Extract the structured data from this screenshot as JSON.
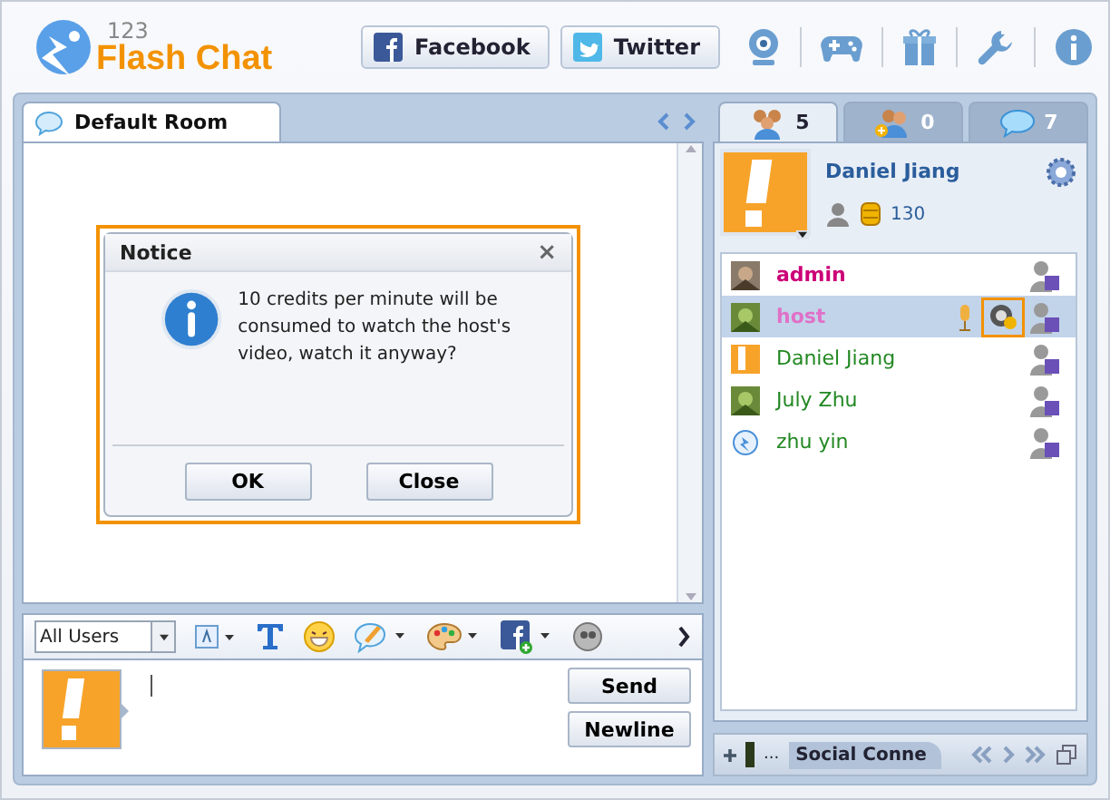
{
  "app": {
    "logo_number": "123",
    "logo_name": "Flash Chat"
  },
  "header_buttons": [
    {
      "label": "Facebook",
      "kind": "facebook"
    },
    {
      "label": "Twitter",
      "kind": "twitter"
    }
  ],
  "room_tabs": [
    {
      "label": "Default Room",
      "selected": true
    }
  ],
  "dialog": {
    "title": "Notice",
    "close": "×",
    "message": "10 credits per minute will be consumed to watch the host's video, watch it anyway?",
    "buttons": [
      "OK",
      "Close"
    ]
  },
  "toolbar": {
    "recipient": "All Users"
  },
  "input": {
    "buttons": [
      "Send",
      "Newline"
    ]
  },
  "side_tabs": [
    {
      "count": "5",
      "kind": "users",
      "selected": true
    },
    {
      "count": "0",
      "kind": "friends",
      "selected": false
    },
    {
      "count": "7",
      "kind": "rooms",
      "selected": false
    }
  ],
  "profile": {
    "name": "Daniel Jiang",
    "credits": "130"
  },
  "users": [
    {
      "name": "admin",
      "color": "#cc0077",
      "bold": true,
      "selected": false,
      "media": false
    },
    {
      "name": "host",
      "color": "#e070c8",
      "bold": true,
      "selected": true,
      "media": true
    },
    {
      "name": "Daniel Jiang",
      "color": "#228822",
      "bold": false,
      "selected": false,
      "kind": "orange",
      "media": false
    },
    {
      "name": "July Zhu",
      "color": "#228822",
      "bold": false,
      "selected": false,
      "media": false
    },
    {
      "name": "zhu yin",
      "color": "#228822",
      "bold": false,
      "selected": false,
      "kind": "bird",
      "media": false
    }
  ],
  "bottom_bar": {
    "label": "Social Conne",
    "ellipsis": "..."
  }
}
